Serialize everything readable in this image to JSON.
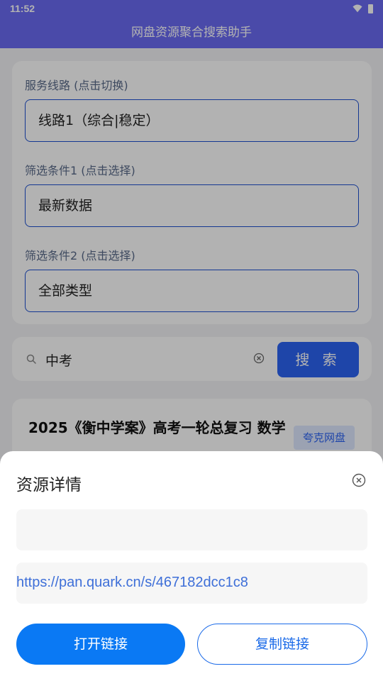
{
  "status": {
    "time": "11:52"
  },
  "app": {
    "title": "网盘资源聚合搜索助手"
  },
  "filters": {
    "line_label": "服务线路 (点击切换)",
    "line_value": "线路1（综合|稳定）",
    "cond1_label": "筛选条件1 (点击选择)",
    "cond1_value": "最新数据",
    "cond2_label": "筛选条件2 (点击选择)",
    "cond2_value": "全部类型"
  },
  "search": {
    "query": "中考",
    "button_label": "搜 索"
  },
  "result": {
    "title": "2025《衡中学案》高考一轮总复习 数学",
    "tag": "夸克网盘"
  },
  "sheet": {
    "title": "资源详情",
    "description": "",
    "link": "https://pan.quark.cn/s/467182dcc1c8",
    "open_label": "打开链接",
    "copy_label": "复制链接"
  },
  "colors": {
    "primary": "#6b6bf3",
    "accent": "#0a79f4",
    "link": "#3e6fd8"
  },
  "icons": {
    "wifi": "wifi-icon",
    "battery": "battery-icon",
    "search": "search-icon",
    "clear": "clear-icon",
    "close": "close-icon"
  }
}
